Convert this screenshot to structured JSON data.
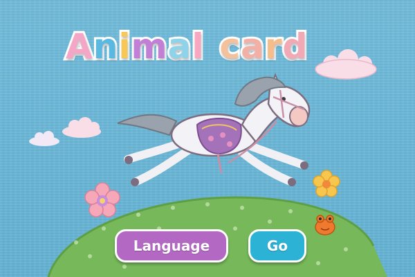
{
  "title": {
    "text": "Animal card",
    "letters": [
      {
        "ch": "A",
        "color": "#f4a6c6"
      },
      {
        "ch": "n",
        "color": "#5ab9e0"
      },
      {
        "ch": "i",
        "color": "#f6c85a"
      },
      {
        "ch": "m",
        "color": "#c27fd6"
      },
      {
        "ch": "a",
        "color": "#8fd3ea"
      },
      {
        "ch": "l",
        "color": "#f7a7c1"
      },
      {
        "ch": "c",
        "color": "#f3c19c"
      },
      {
        "ch": "a",
        "color": "#f2b0a6"
      },
      {
        "ch": "r",
        "color": "#f6bd8c"
      },
      {
        "ch": "d",
        "color": "#f0a9b5"
      }
    ]
  },
  "buttons": {
    "language_label": "Language",
    "go_label": "Go"
  },
  "colors": {
    "sky": "#69b6d6",
    "hill": "#76b85a",
    "language_button": "#b368c4",
    "go_button": "#2bb2d4"
  },
  "icons": [
    "horse-illustration",
    "cloud-icon",
    "flower-icon",
    "frog-icon"
  ]
}
